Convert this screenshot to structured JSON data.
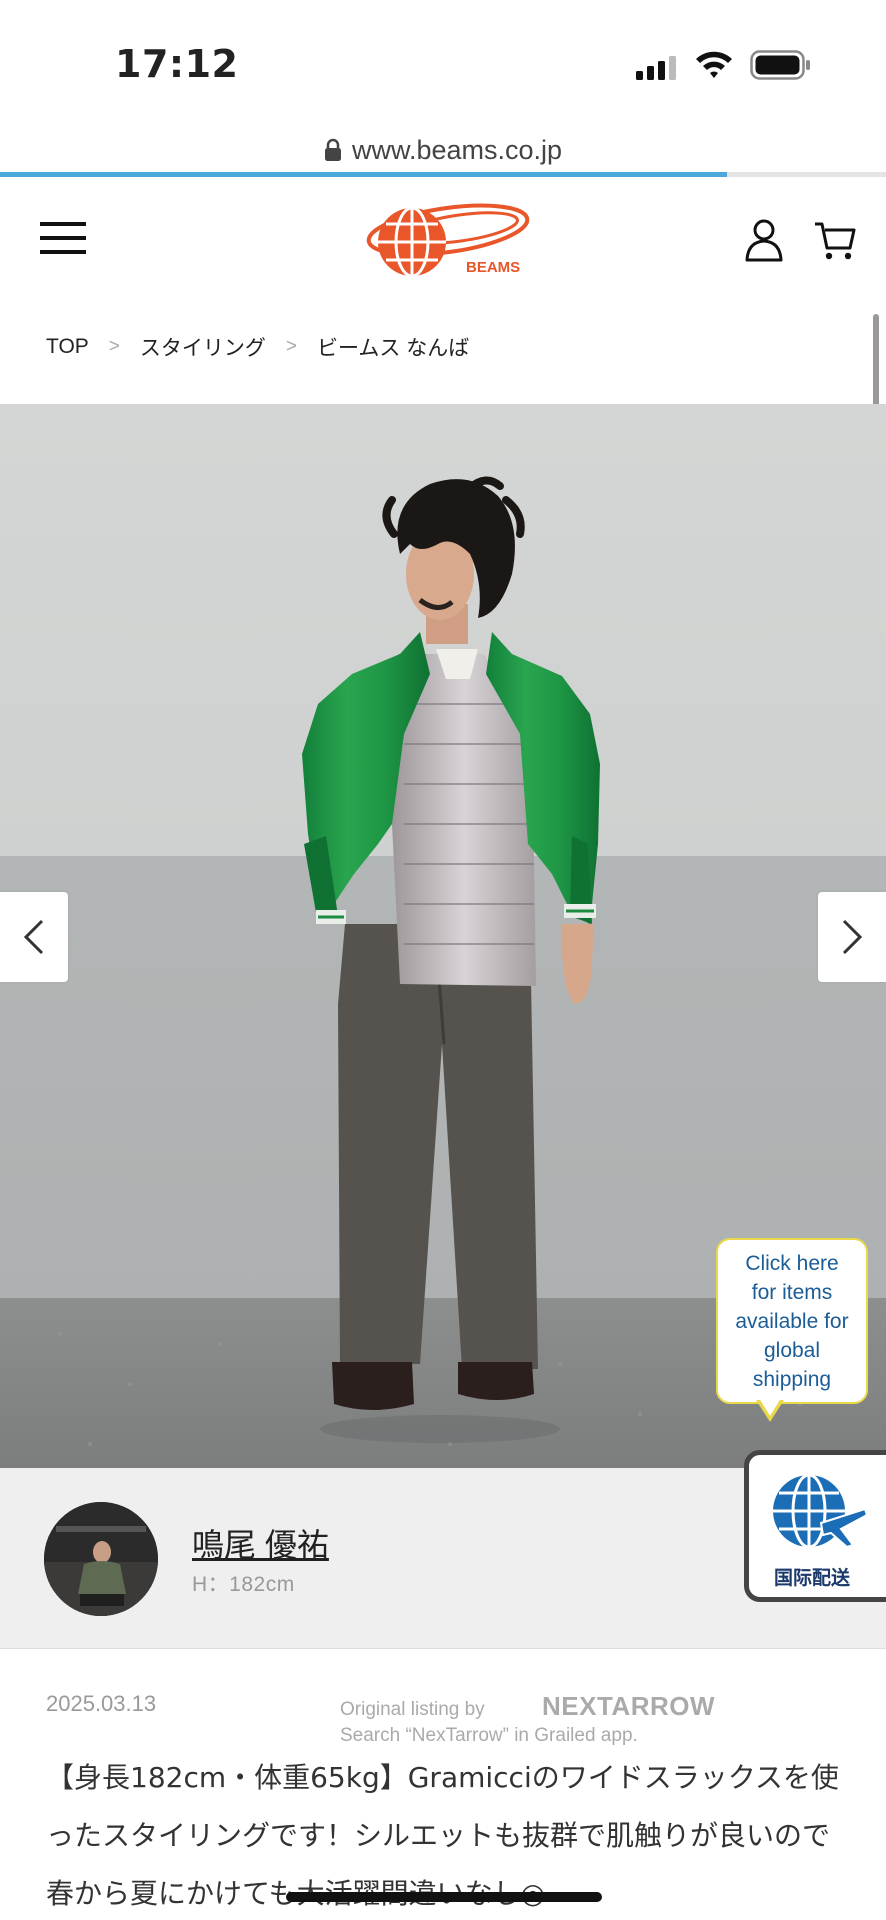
{
  "status_bar": {
    "time": "17:12",
    "icons": [
      "cellular-signal-icon",
      "wifi-icon",
      "battery-icon"
    ]
  },
  "browser": {
    "url": "www.beams.co.jp",
    "load_progress": 0.82
  },
  "header": {
    "logo_text": "BEAMS",
    "brand_color": "#e8562a",
    "icons": [
      "menu-icon",
      "user-icon",
      "cart-icon"
    ]
  },
  "breadcrumb": {
    "items": [
      "TOP",
      "スタイリング",
      "ビームス なんば"
    ],
    "separator": ">"
  },
  "photo": {
    "prev_icon": "chevron-left-icon",
    "next_icon": "chevron-right-icon"
  },
  "global_shipping": {
    "bubble_text": "Click here for items available for global shipping",
    "badge_label": "国际配送",
    "accent": "#1b5d96"
  },
  "staff": {
    "name": "鳴尾 優祐",
    "height": "H：182cm"
  },
  "post": {
    "date": "2025.03.13",
    "watermark_line1": "Original listing by",
    "watermark_brand": "NEXTARROW",
    "watermark_line2": "Search “NexTarrow” in Grailed app.",
    "body": "【身長182cm・体重65kg】Gramicciのワイドスラックスを使ったスタイリングです！シルエットも抜群で肌触りが良いので春から夏にかけても大活躍間違いなし◎"
  }
}
